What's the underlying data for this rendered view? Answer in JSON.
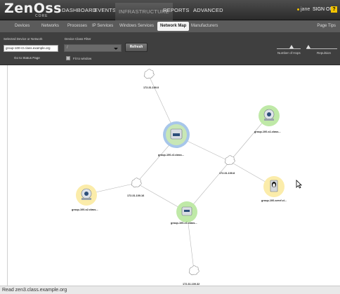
{
  "app": {
    "logo_text": "ZenOss",
    "logo_sub": "CORE"
  },
  "topnav": {
    "items": [
      "DASHBOARD",
      "EVENTS",
      "INFRASTRUCTURE",
      "REPORTS",
      "ADVANCED"
    ],
    "active": "INFRASTRUCTURE",
    "user": "jane",
    "signout": "SIGN OUT",
    "help": "?"
  },
  "subnav": {
    "items": [
      "Devices",
      "Networks",
      "Processes",
      "IP Services",
      "Windows Services",
      "Network Map",
      "Manufacturers"
    ],
    "active": "Network Map",
    "page_tips": "Page Tips"
  },
  "controls": {
    "selected_device_label": "Selected Device or Network",
    "selected_device_value": "group-100-r2.class.example.org",
    "device_class_filter_label": "Device Class Filter",
    "device_class_filter_value": "/",
    "refresh_label": "Refresh",
    "goto_status": "Go to Status Page",
    "fit_window_label": "Fit to window",
    "hops_label": "Number of Hops",
    "repulsion_label": "Repulsion"
  },
  "map": {
    "nodes": [
      {
        "id": "n-net-0",
        "label": "172.31.100.0",
        "kind": "network"
      },
      {
        "id": "n-r2",
        "label": "group-100-r2.class...",
        "kind": "router"
      },
      {
        "id": "n-s1",
        "label": "group-100-s1.class...",
        "kind": "router"
      },
      {
        "id": "n-net-8",
        "label": "172.31.100.8",
        "kind": "network"
      },
      {
        "id": "n-serv",
        "label": "group-100-servf.cl...",
        "kind": "server"
      },
      {
        "id": "n-s2",
        "label": "group-100-s2.class...",
        "kind": "router"
      },
      {
        "id": "n-net-16",
        "label": "172.31.100.16",
        "kind": "network"
      },
      {
        "id": "n-c1",
        "label": "group-100-c1.class...",
        "kind": "router"
      },
      {
        "id": "n-net-32",
        "label": "172.31.100.32",
        "kind": "network"
      }
    ],
    "colors": {
      "router_halo": "#bfe9a7",
      "selected_ring": "#7da7d8",
      "warning_halo": "#fbecaa",
      "edge": "#b8b8b8"
    }
  },
  "status": {
    "text": "Read zen3.class.example.org"
  }
}
